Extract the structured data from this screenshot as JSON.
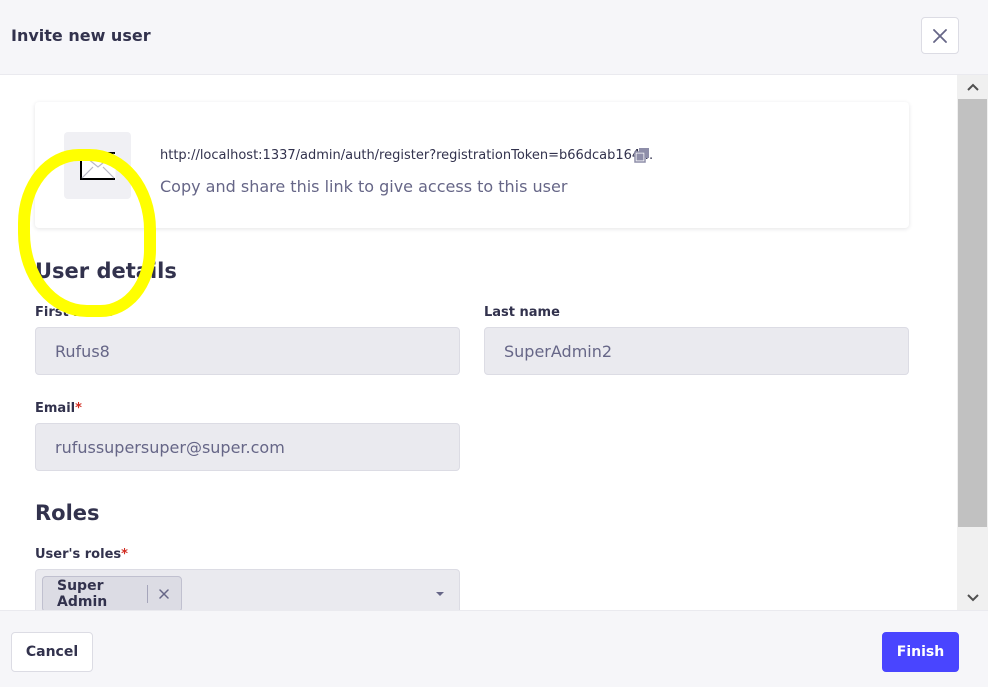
{
  "header": {
    "title": "Invite new user",
    "close_icon": "close-icon"
  },
  "invite_link": {
    "url": "http://localhost:1337/admin/auth/register?registrationToken=b66dcab164…",
    "hint": "Copy and share this link to give access to this user",
    "envelope_icon": "envelope-icon",
    "copy_icon": "copy-icon"
  },
  "user_details": {
    "title": "User details",
    "first_name": {
      "label": "First name",
      "value": "Rufus8",
      "required": true
    },
    "last_name": {
      "label": "Last name",
      "value": "SuperAdmin2",
      "required": false
    },
    "email": {
      "label": "Email",
      "value": "rufussupersuper@super.com",
      "required": true
    }
  },
  "roles": {
    "title": "Roles",
    "label": "User's roles",
    "required": true,
    "selected": [
      "Super Admin"
    ]
  },
  "footer": {
    "cancel_label": "Cancel",
    "finish_label": "Finish"
  },
  "colors": {
    "primary": "#4945ff",
    "required": "#d02b20",
    "highlight": "#ffff00"
  }
}
